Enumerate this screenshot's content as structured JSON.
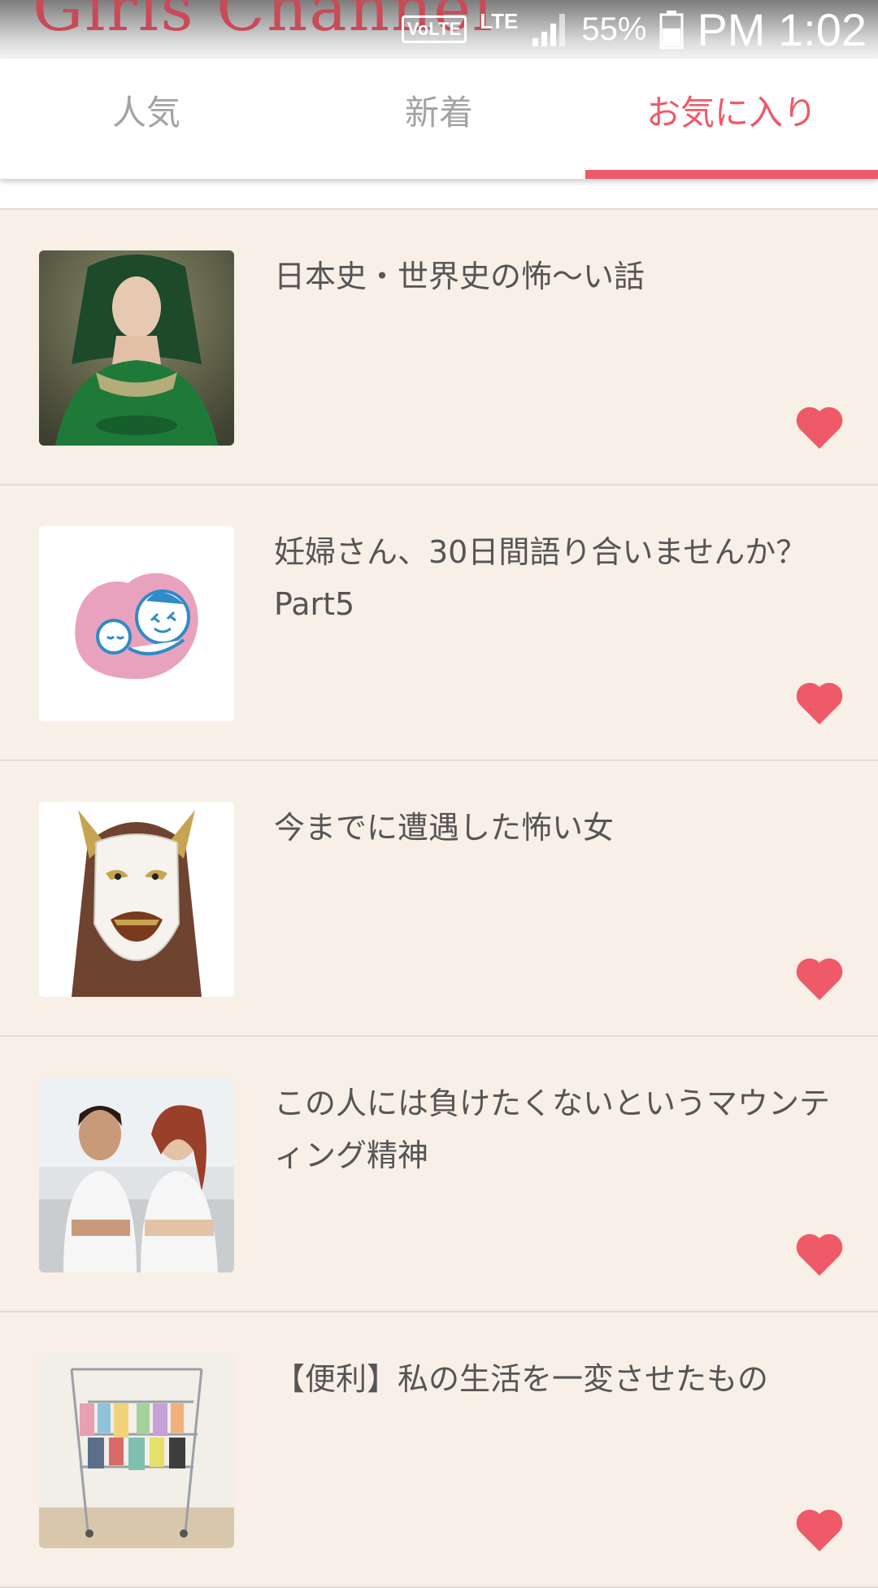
{
  "app": {
    "title": "Girls Channel"
  },
  "status": {
    "volte": "VoLTE",
    "lte": "LTE",
    "battery": "55%",
    "time": "PM 1:02"
  },
  "tabs": [
    {
      "label": "人気",
      "active": false
    },
    {
      "label": "新着",
      "active": false
    },
    {
      "label": "お気に入り",
      "active": true
    }
  ],
  "items": [
    {
      "title": "日本史・世界史の怖〜い話",
      "thumb": "woman-green-dress-photo",
      "favorited": true
    },
    {
      "title": "妊婦さん、30日間語り合いませんか？Part5",
      "thumb": "maternity-mark-heart",
      "favorited": true
    },
    {
      "title": "今までに遭遇した怖い女",
      "thumb": "hannya-mask-photo",
      "favorited": true
    },
    {
      "title": "この人には負けたくないというマウンティング精神",
      "thumb": "two-women-arms-crossed-photo",
      "favorited": true
    },
    {
      "title": "【便利】私の生活を一変させたもの",
      "thumb": "drying-rack-photo",
      "favorited": true
    }
  ],
  "colors": {
    "accent": "#ef5a68",
    "background": "#f8f0e6",
    "heart": "#ef5a68"
  }
}
